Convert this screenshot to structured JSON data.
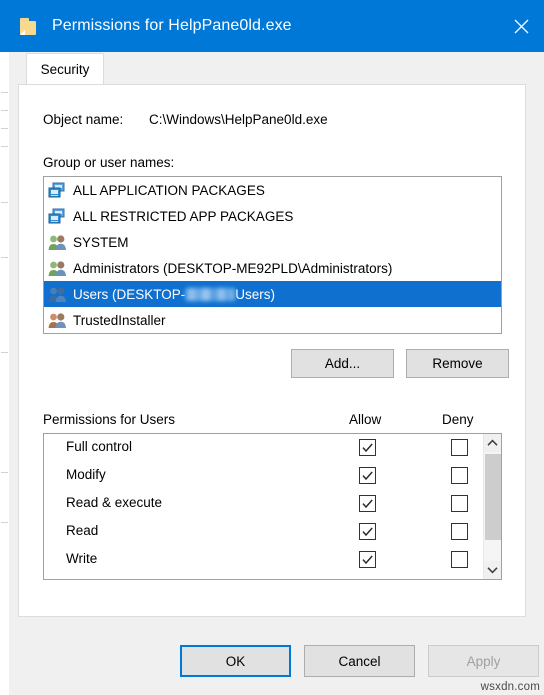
{
  "window": {
    "title": "Permissions for HelpPane0ld.exe",
    "icon": "folder-icon",
    "close_label": "✕",
    "titlebar_color": "#0078d7"
  },
  "tabs": [
    {
      "label": "Security",
      "selected": true
    }
  ],
  "object_name": {
    "label": "Object name:",
    "value": "C:\\Windows\\HelpPane0ld.exe"
  },
  "group_list": {
    "label": "Group or user names:",
    "selection_color": "#0f70d0",
    "items": [
      {
        "name": "ALL APPLICATION PACKAGES",
        "icon": "app-package-icon",
        "selected": false
      },
      {
        "name": "ALL RESTRICTED APP PACKAGES",
        "icon": "app-package-icon",
        "selected": false
      },
      {
        "name": "SYSTEM",
        "icon": "users-group-icon",
        "selected": false
      },
      {
        "name": "Administrators (DESKTOP-ME92PLD\\Administrators)",
        "icon": "users-group-icon",
        "selected": false
      },
      {
        "name_prefix": "Users (DESKTOP-",
        "name_suffix": "Users)",
        "redacted": true,
        "icon": "users-group-icon",
        "selected": true
      },
      {
        "name": "TrustedInstaller",
        "icon": "users-group-icon",
        "selected": false
      }
    ]
  },
  "list_buttons": {
    "add": "Add...",
    "remove": "Remove"
  },
  "permissions": {
    "label": "Permissions for Users",
    "columns": {
      "allow": "Allow",
      "deny": "Deny"
    },
    "rows": [
      {
        "name": "Full control",
        "allow": true,
        "deny": false
      },
      {
        "name": "Modify",
        "allow": true,
        "deny": false
      },
      {
        "name": "Read & execute",
        "allow": true,
        "deny": false
      },
      {
        "name": "Read",
        "allow": true,
        "deny": false
      },
      {
        "name": "Write",
        "allow": true,
        "deny": false
      },
      {
        "name": "",
        "allow": false,
        "deny": false,
        "partial": true
      }
    ],
    "scrollbar": {
      "up": "scroll-up-arrow",
      "down": "scroll-down-arrow"
    }
  },
  "footer": {
    "ok": "OK",
    "cancel": "Cancel",
    "apply": "Apply",
    "apply_disabled": true,
    "focus_color": "#0078d7"
  },
  "watermark": "wsxdn.com"
}
